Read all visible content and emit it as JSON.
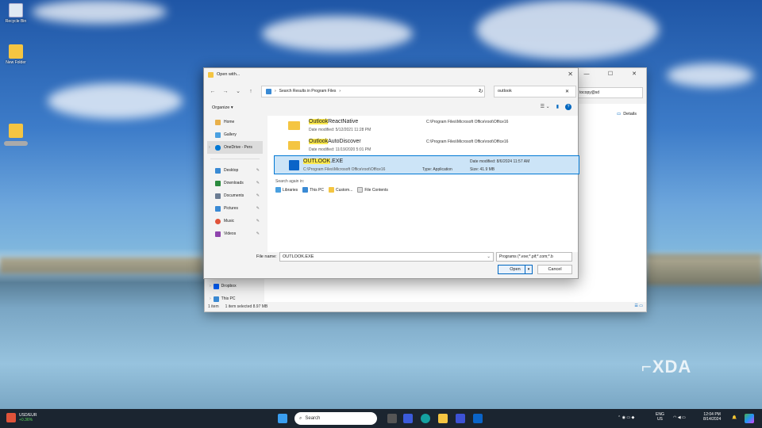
{
  "desktop": {
    "icons": [
      {
        "label": "Recycle Bin",
        "icon": "recycle-bin-icon"
      },
      {
        "label": "New Folder",
        "icon": "folder-icon"
      },
      {
        "label": "",
        "icon": "folder-icon"
      }
    ],
    "watermark": "XDA"
  },
  "explorer_bg": {
    "controls": [
      "—",
      "☐",
      "✕"
    ],
    "search_text": "tocopy@sd",
    "details_label": "Details",
    "nav_items": [
      {
        "label": "Dropbox",
        "icon": "dropbox-icon"
      },
      {
        "label": "This PC",
        "icon": "pc-icon"
      }
    ],
    "status": {
      "count": "1 item",
      "selected": "1 item selected  8.97 MB"
    }
  },
  "dialog": {
    "title": "Open with...",
    "close": "✕",
    "address": "Search Results in Program Files",
    "search_value": "outlook",
    "organize": "Organize ▾",
    "nav": [
      {
        "label": "Home",
        "icon": "home-icon"
      },
      {
        "label": "Gallery",
        "icon": "gallery-icon"
      },
      {
        "label": "OneDrive - Pers",
        "icon": "cloud-icon"
      },
      {
        "label": "Desktop",
        "icon": "desktop-icon"
      },
      {
        "label": "Downloads",
        "icon": "download-icon"
      },
      {
        "label": "Documents",
        "icon": "document-icon"
      },
      {
        "label": "Pictures",
        "icon": "pictures-icon"
      },
      {
        "label": "Music",
        "icon": "music-icon"
      },
      {
        "label": "Videos",
        "icon": "videos-icon"
      }
    ],
    "results": [
      {
        "name_hl": "Outlook",
        "name_rest": "ReactNative",
        "sub": "Date modified: 5/12/2021 11:28 PM",
        "path": "C:\\Program Files\\Microsoft Office\\root\\Office16",
        "path2": "",
        "icon": "folder-icon"
      },
      {
        "name_hl": "Outlook",
        "name_rest": "AutoDiscover",
        "sub": "Date modified: 11/19/2020 5:01 PM",
        "path": "C:\\Program Files\\Microsoft Office\\root\\Office16",
        "path2": "",
        "icon": "folder-icon"
      },
      {
        "name_hl": "OUTLOOK",
        "name_rest": ".EXE",
        "sub": "C:\\Program Files\\Microsoft Office\\root\\Office16",
        "path": "Date modified: 8/6/2024 11:57 AM",
        "path2": "Size: 41.9 MB",
        "type": "Type: Application",
        "icon": "outlook-icon"
      }
    ],
    "search_again": "Search again in:",
    "search_again_items": [
      {
        "label": "Libraries",
        "icon": "libraries-icon"
      },
      {
        "label": "This PC",
        "icon": "pc-icon"
      },
      {
        "label": "Custom...",
        "icon": "folder-icon"
      },
      {
        "label": "File Contents",
        "icon": "file-icon"
      }
    ],
    "file_name_label": "File name:",
    "file_name_value": "OUTLOOK.EXE",
    "file_type": "Programs (*.exe;*.pif;*.com;*.b",
    "open_label": "Open",
    "cancel_label": "Cancel"
  },
  "taskbar": {
    "ticker": {
      "pair": "USD/EUR",
      "change": "+0.36%"
    },
    "search_placeholder": "Search",
    "lang": "ENG",
    "region": "US",
    "time": "12:04 PM",
    "date": "8/14/2024"
  }
}
